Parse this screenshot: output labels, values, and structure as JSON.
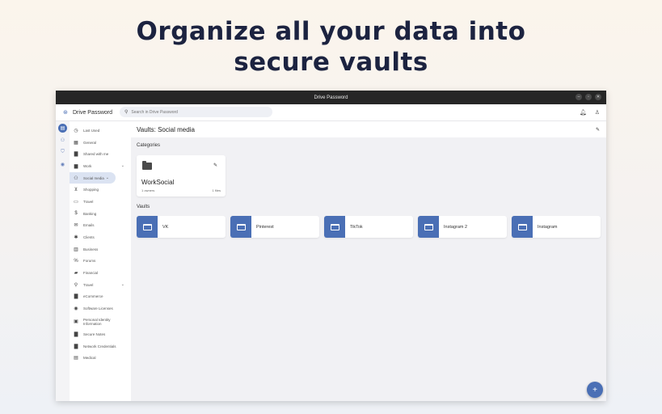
{
  "headline": {
    "line1": "Organize all your data into",
    "line2": "secure vaults"
  },
  "window": {
    "title": "Drive Password",
    "controls": [
      "–",
      "▫",
      "✕"
    ]
  },
  "appbar": {
    "app_name": "Drive Password",
    "search_placeholder": "Search in Drive Password"
  },
  "sidebar": {
    "items": [
      {
        "label": "Last Used",
        "icon": "clock-icon",
        "glyph": "◷"
      },
      {
        "label": "General",
        "icon": "grid-icon",
        "glyph": "▦"
      },
      {
        "label": "Shared with me",
        "icon": "shared-folder-icon",
        "glyph": "▇"
      },
      {
        "label": "Work",
        "icon": "briefcase-icon",
        "glyph": "▆",
        "chevron": "⌄"
      },
      {
        "label": "Social media",
        "icon": "people-icon",
        "glyph": "⚇",
        "chevron": "⌄",
        "selected": true
      },
      {
        "label": "Shopping",
        "icon": "cart-icon",
        "glyph": "⊻"
      },
      {
        "label": "Travel",
        "icon": "car-icon",
        "glyph": "▭"
      },
      {
        "label": "Banking",
        "icon": "dollar-icon",
        "glyph": "$"
      },
      {
        "label": "Emails",
        "icon": "email-icon",
        "glyph": "✉"
      },
      {
        "label": "Clients",
        "icon": "puzzle-icon",
        "glyph": "✱"
      },
      {
        "label": "Business",
        "icon": "building-icon",
        "glyph": "▥"
      },
      {
        "label": "Forums",
        "icon": "percent-icon",
        "glyph": "%"
      },
      {
        "label": "Financial",
        "icon": "lock-icon",
        "glyph": "▰"
      },
      {
        "label": "Travel",
        "icon": "bike-icon",
        "glyph": "⚲",
        "chevron": "⌄"
      },
      {
        "label": "eCommerce",
        "icon": "folder-icon",
        "glyph": "▇"
      },
      {
        "label": "Software Licenses",
        "icon": "disc-icon",
        "glyph": "◉"
      },
      {
        "label": "Personal Identity Information",
        "icon": "id-card-icon",
        "glyph": "▣",
        "two_line": true
      },
      {
        "label": "Secure Notes",
        "icon": "folder-icon",
        "glyph": "▇"
      },
      {
        "label": "Network Credentials",
        "icon": "folder-icon",
        "glyph": "▇"
      },
      {
        "label": "Medical",
        "icon": "medical-icon",
        "glyph": "▤"
      }
    ]
  },
  "main": {
    "vault_title": "Vaults: Social media",
    "categories_label": "Categories",
    "category": {
      "name": "WorkSocial",
      "owners": "1 owners",
      "files": "1 files"
    },
    "vaults_label": "Vaults",
    "vaults": [
      "VK",
      "Pinterest",
      "TikTok",
      "Instagram 2",
      "Instagram"
    ]
  },
  "fab": "+",
  "colors": {
    "accent": "#4a6fb5",
    "selected_bg": "#dbe3f2",
    "headline": "#1c2340",
    "titlebar": "#262626"
  }
}
